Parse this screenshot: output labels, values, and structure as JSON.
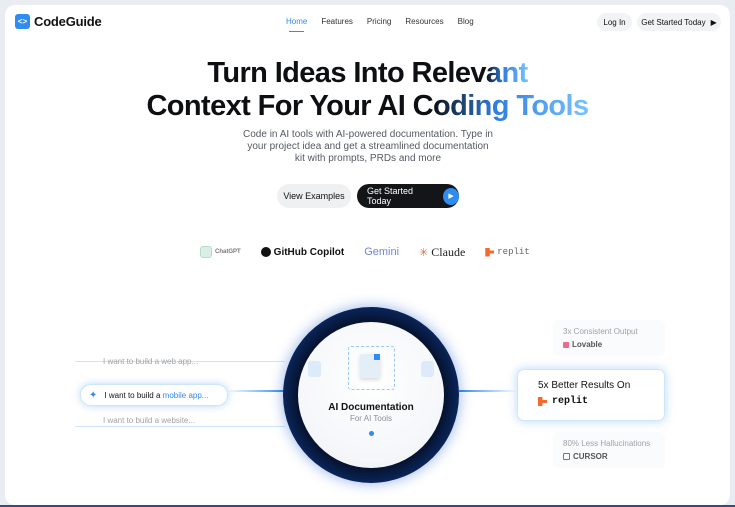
{
  "brand": {
    "name": "CodeGuide",
    "logo_glyph": "<>"
  },
  "nav": {
    "items": [
      "Home",
      "Features",
      "Pricing",
      "Resources",
      "Blog"
    ],
    "active": "Home",
    "login_label": "Log In",
    "cta_label": "Get Started Today"
  },
  "hero": {
    "title_line1_a": "Turn Ideas Into Relev",
    "title_line1_b": "ant",
    "title_line2_a": "Context For Your AI C",
    "title_line2_b": "oding Tools",
    "subtitle": "Code in AI tools with AI-powered documentation. Type in your project idea and get a streamlined documentation kit with prompts, PRDs and more",
    "btn_examples": "View Examples",
    "btn_cta": "Get Started Today"
  },
  "logos": {
    "chatgpt": "ChatGPT",
    "copilot": "GitHub Copilot",
    "gemini": "Gemini",
    "claude": "Claude",
    "replit": "replit"
  },
  "prompts": {
    "top": "I want to build a web app...",
    "active_prefix": "I want to build a ",
    "active_accent": "mobile app...",
    "bottom": "I want to build a website..."
  },
  "center": {
    "title": "AI Documentation",
    "subtitle": "For AI Tools"
  },
  "results": {
    "top": {
      "title": "3x Consistent Output",
      "brand": "Lovable"
    },
    "main": {
      "title": "5x Better Results On",
      "brand": "replit"
    },
    "bottom": {
      "title": "80% Less Hallucinations",
      "brand": "CURSOR"
    }
  },
  "colors": {
    "accent": "#2f8cf0",
    "dark": "#141518",
    "ring": "#1455c8"
  }
}
